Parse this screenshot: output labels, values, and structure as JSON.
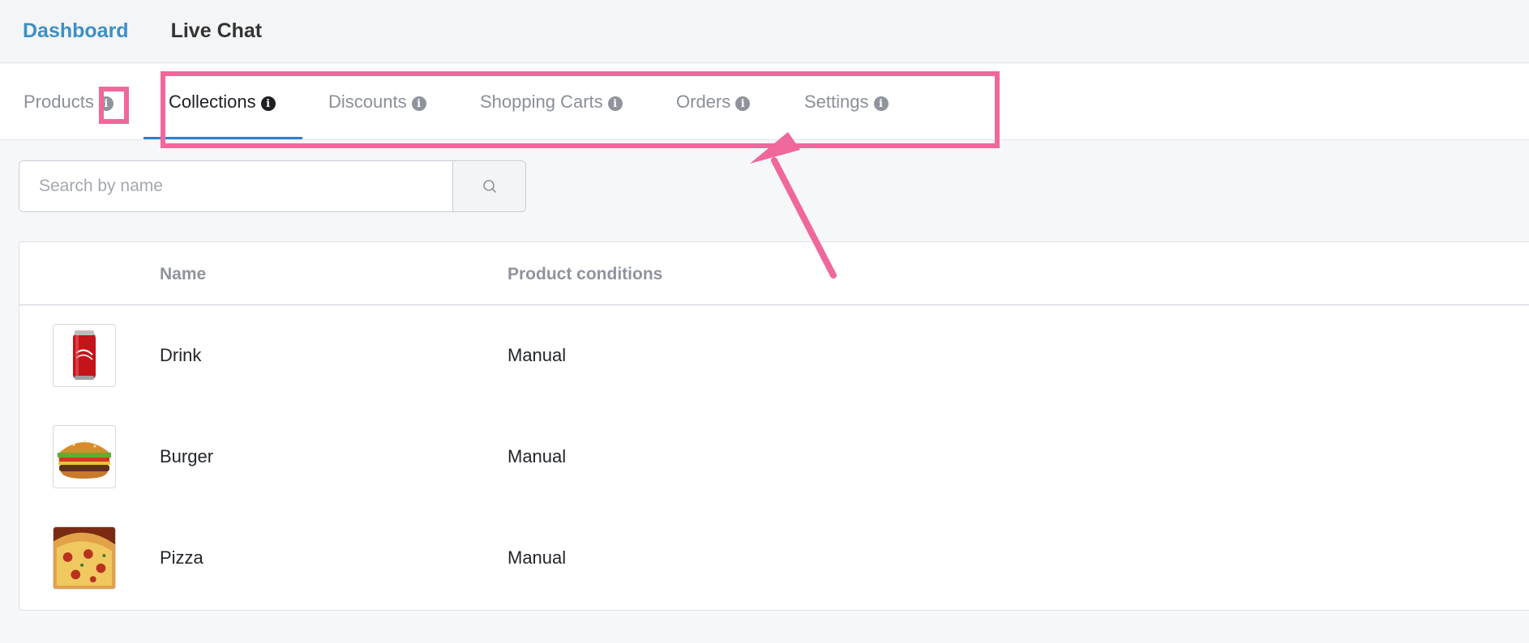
{
  "topnav": {
    "dashboard": "Dashboard",
    "live_chat": "Live Chat"
  },
  "tabs": [
    {
      "label": "Products",
      "active": false
    },
    {
      "label": "Collections",
      "active": true
    },
    {
      "label": "Discounts",
      "active": false
    },
    {
      "label": "Shopping Carts",
      "active": false
    },
    {
      "label": "Orders",
      "active": false
    },
    {
      "label": "Settings",
      "active": false
    }
  ],
  "info_glyph": "i",
  "search": {
    "placeholder": "Search by name",
    "value": "",
    "icon": "search-icon"
  },
  "table": {
    "columns": [
      "Name",
      "Product conditions"
    ],
    "rows": [
      {
        "name": "Drink",
        "condition": "Manual",
        "thumb": "soda-can"
      },
      {
        "name": "Burger",
        "condition": "Manual",
        "thumb": "burger"
      },
      {
        "name": "Pizza",
        "condition": "Manual",
        "thumb": "pizza"
      }
    ]
  },
  "colors": {
    "accent": "#3b8fc7",
    "tab_underline": "#2d7fd3",
    "annotation": "#f0679b"
  }
}
